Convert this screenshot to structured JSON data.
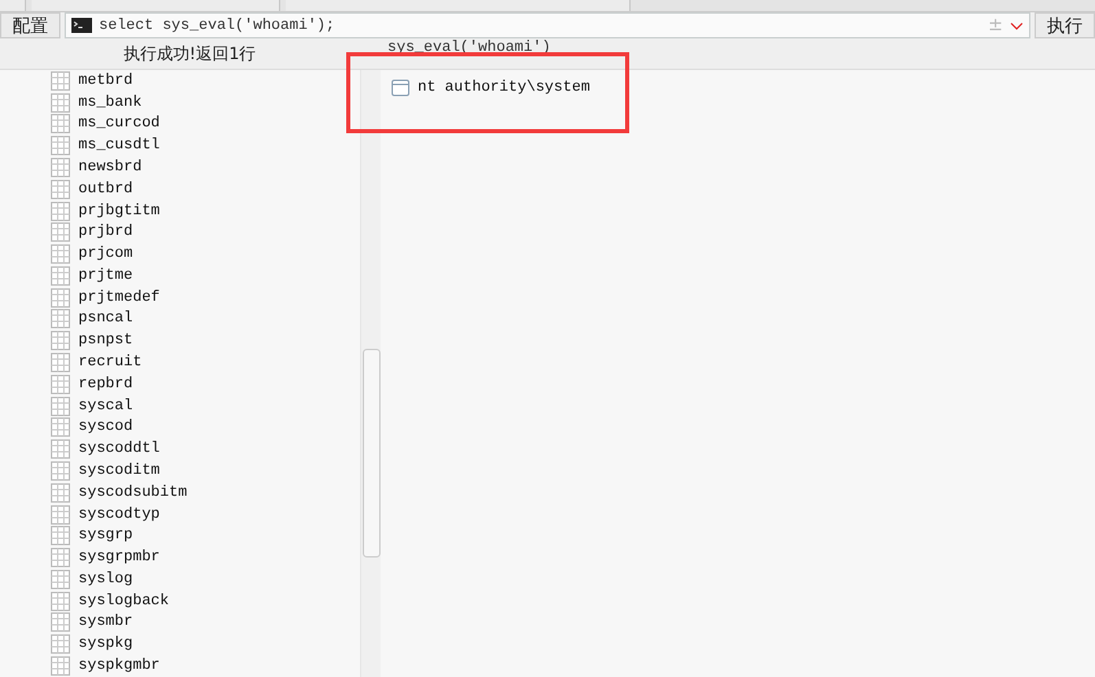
{
  "toolbar": {
    "config_button": "配置",
    "query": "select sys_eval('whoami');",
    "clear_glyph": "±",
    "run_button": "执行"
  },
  "status": "执行成功!返回1行",
  "tables": [
    "metbrd",
    "ms_bank",
    "ms_curcod",
    "ms_cusdtl",
    "newsbrd",
    "outbrd",
    "prjbgtitm",
    "prjbrd",
    "prjcom",
    "prjtme",
    "prjtmedef",
    "psncal",
    "psnpst",
    "recruit",
    "repbrd",
    "syscal",
    "syscod",
    "syscoddtl",
    "syscoditm",
    "syscodsubitm",
    "syscodtyp",
    "sysgrp",
    "sysgrpmbr",
    "syslog",
    "syslogback",
    "sysmbr",
    "syspkg",
    "syspkgmbr"
  ],
  "result": {
    "column": "sys_eval('whoami')",
    "rows": [
      "nt authority\\system"
    ]
  }
}
